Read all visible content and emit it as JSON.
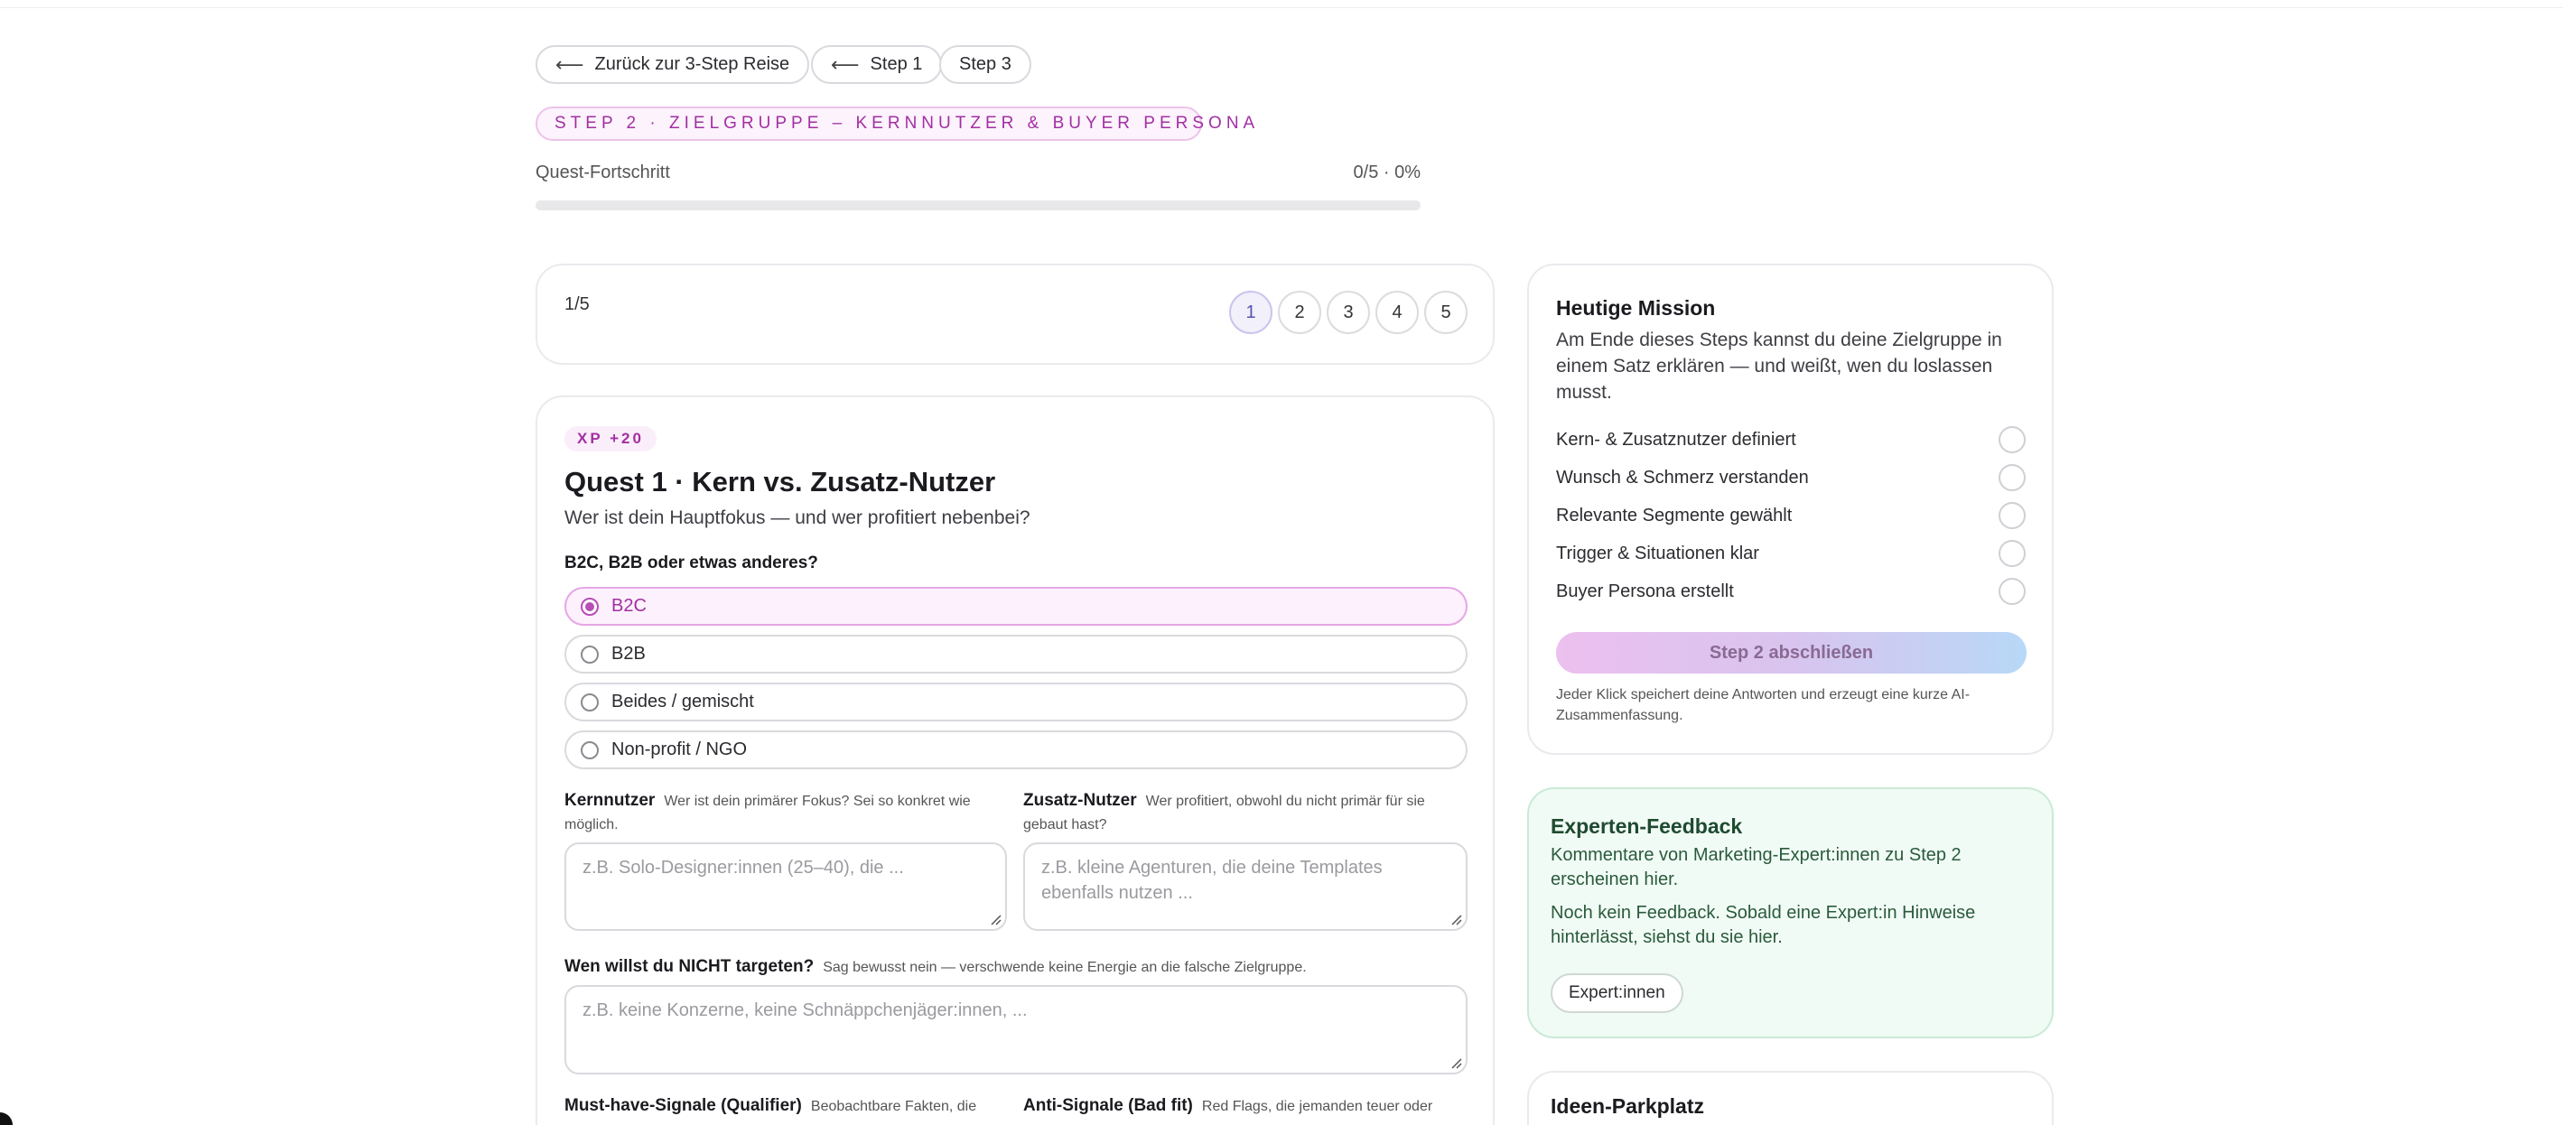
{
  "nav": {
    "back_label": "Zurück zur 3-Step Reise",
    "step1_label": "Step 1",
    "step3_label": "Step 3"
  },
  "step_tag": "STEP 2 · ZIELGRUPPE – KERNNUTZER & BUYER PERSONA",
  "progress": {
    "label": "Quest-Fortschritt",
    "value_text": "0/5 · 0%",
    "fraction": 0
  },
  "pager": {
    "count": "1/5",
    "pages": [
      "1",
      "2",
      "3",
      "4",
      "5"
    ],
    "active": "1"
  },
  "quest": {
    "xp": "XP +20",
    "title": "Quest 1 · Kern vs. Zusatz-Nutzer",
    "subtitle": "Wer ist dein Hauptfokus — und wer profitiert nebenbei?",
    "question": "B2C, B2B oder etwas anderes?",
    "options": [
      "B2C",
      "B2B",
      "Beides / gemischt",
      "Non-profit / NGO"
    ],
    "selected": "B2C",
    "core_label": "Kernnutzer",
    "core_hint": "Wer ist dein primärer Fokus? Sei so konkret wie möglich.",
    "core_placeholder": "z.B. Solo-Designer:innen (25–40), die ...",
    "extra_label": "Zusatz-Nutzer",
    "extra_hint": "Wer profitiert, obwohl du nicht primär für sie gebaut hast?",
    "extra_placeholder": "z.B. kleine Agenturen, die deine Templates ebenfalls nutzen ...",
    "not_target_label": "Wen willst du NICHT targeten?",
    "not_target_hint": "Sag bewusst nein — verschwende keine Energie an die falsche Zielgruppe.",
    "not_target_placeholder": "z.B. keine Konzerne, keine Schnäppchenjäger:innen, ...",
    "must_have_label": "Must-have-Signale (Qualifier)",
    "must_have_hint": "Beobachtbare Fakten, die",
    "anti_label": "Anti-Signale (Bad fit)",
    "anti_hint": "Red Flags, die jemanden teuer oder"
  },
  "mission": {
    "title": "Heutige Mission",
    "text": "Am Ende dieses Steps kannst du deine Zielgruppe in einem Satz erklären — und weißt, wen du loslassen musst.",
    "checklist": [
      "Kern- & Zusatznutzer definiert",
      "Wunsch & Schmerz verstanden",
      "Relevante Segmente gewählt",
      "Trigger & Situationen klar",
      "Buyer Persona erstellt"
    ],
    "button": "Step 2 abschließen",
    "note": "Jeder Klick speichert deine Antworten und erzeugt eine kurze AI-Zusammenfassung."
  },
  "expert": {
    "title": "Experten-Feedback",
    "text": "Kommentare von Marketing-Expert:innen zu Step 2 erscheinen hier.",
    "empty": "Noch kein Feedback. Sobald eine Expert:in Hinweise hinterlässt, siehst du sie hier.",
    "button": "Expert:innen"
  },
  "ideas": {
    "title": "Ideen-Parkplatz"
  },
  "colors": {
    "accent": "#b84db8",
    "accent_light": "#fdf1fd",
    "expert_bg": "#f1fbf5"
  }
}
